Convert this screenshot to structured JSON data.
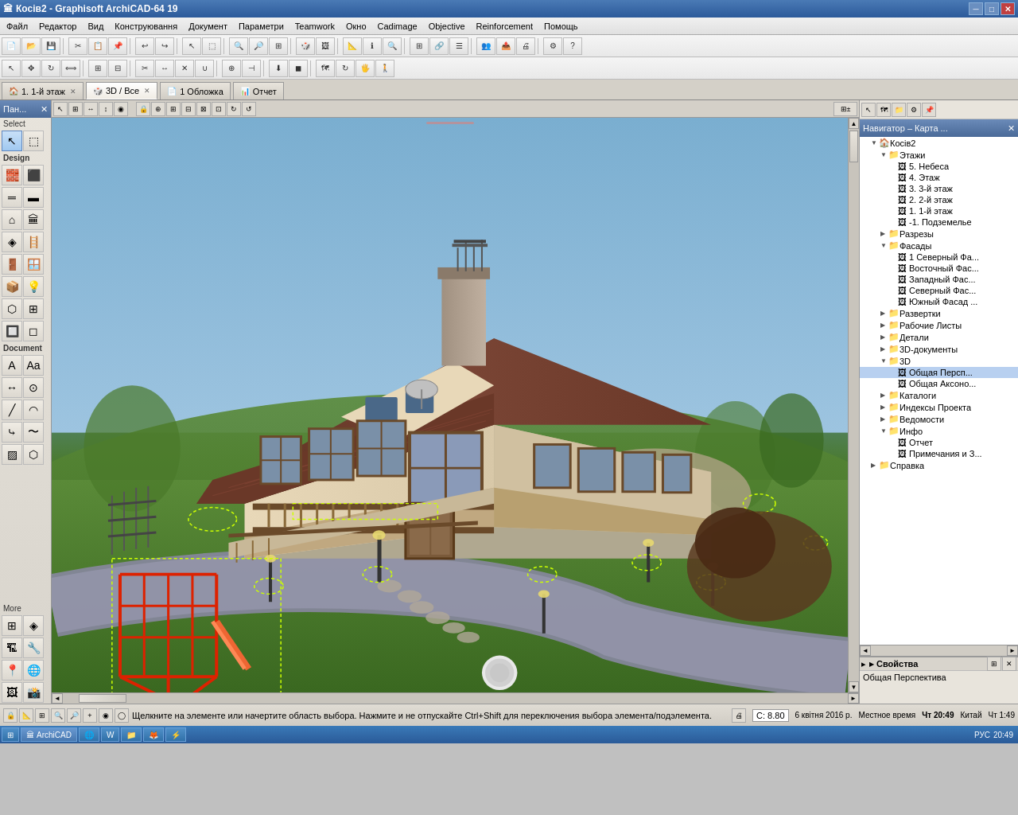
{
  "app": {
    "title": "Косів2 - Graphisoft ArchiCAD-64 19",
    "window_controls": [
      "minimize",
      "maximize",
      "close"
    ]
  },
  "menubar": {
    "items": [
      "Файл",
      "Редактор",
      "Вид",
      "Конструювання",
      "Документ",
      "Параметри",
      "Teamwork",
      "Окно",
      "Cadimage",
      "Objective",
      "Reinforcement",
      "Помощь"
    ]
  },
  "tabs": [
    {
      "label": "1. 1-й этаж",
      "icon": "floor",
      "active": false,
      "closeable": true
    },
    {
      "label": "3D / Все",
      "icon": "3d",
      "active": true,
      "closeable": true
    },
    {
      "label": "1 Обложка",
      "icon": "doc",
      "active": false,
      "closeable": false
    },
    {
      "label": "Отчет",
      "icon": "report",
      "active": false,
      "closeable": false
    }
  ],
  "left_panel": {
    "header": "Пан...",
    "select_label": "Select",
    "more_label": "More",
    "design_label": "Design",
    "document_label": "Document"
  },
  "navigator": {
    "header": "Навигатор – Карта ...",
    "tree": [
      {
        "level": 0,
        "label": "Косів2",
        "icon": "🏠",
        "expanded": true
      },
      {
        "level": 1,
        "label": "Этажи",
        "icon": "📁",
        "expanded": true
      },
      {
        "level": 2,
        "label": "5. Небеса",
        "icon": "🖼"
      },
      {
        "level": 2,
        "label": "4. Этаж",
        "icon": "🖼"
      },
      {
        "level": 2,
        "label": "3. 3-й этаж",
        "icon": "🖼"
      },
      {
        "level": 2,
        "label": "2. 2-й этаж",
        "icon": "🖼"
      },
      {
        "level": 2,
        "label": "1. 1-й этаж",
        "icon": "🖼"
      },
      {
        "level": 2,
        "label": "-1. Подземелье",
        "icon": "🖼"
      },
      {
        "level": 1,
        "label": "Разрезы",
        "icon": "📁"
      },
      {
        "level": 1,
        "label": "Фасады",
        "icon": "📁",
        "expanded": true
      },
      {
        "level": 2,
        "label": "1 Северный Фа...",
        "icon": "🖼"
      },
      {
        "level": 2,
        "label": "Восточный Фас...",
        "icon": "🖼"
      },
      {
        "level": 2,
        "label": "Западный Фас...",
        "icon": "🖼"
      },
      {
        "level": 2,
        "label": "Северный Фас...",
        "icon": "🖼"
      },
      {
        "level": 2,
        "label": "Южный Фасад ...",
        "icon": "🖼"
      },
      {
        "level": 1,
        "label": "Развертки",
        "icon": "📁"
      },
      {
        "level": 1,
        "label": "Рабочие Листы",
        "icon": "📁"
      },
      {
        "level": 1,
        "label": "Детали",
        "icon": "📁"
      },
      {
        "level": 1,
        "label": "3D-документы",
        "icon": "📁"
      },
      {
        "level": 1,
        "label": "3D",
        "icon": "📁",
        "expanded": true
      },
      {
        "level": 2,
        "label": "Общая Персп...",
        "icon": "🖼",
        "selected": true
      },
      {
        "level": 2,
        "label": "Общая Аксоно...",
        "icon": "🖼"
      },
      {
        "level": 1,
        "label": "Каталоги",
        "icon": "📁"
      },
      {
        "level": 1,
        "label": "Индексы Проекта",
        "icon": "📁"
      },
      {
        "level": 1,
        "label": "Ведомости",
        "icon": "📁"
      },
      {
        "level": 1,
        "label": "Инфо",
        "icon": "📁",
        "expanded": true
      },
      {
        "level": 2,
        "label": "Отчет",
        "icon": "🖼"
      },
      {
        "level": 2,
        "label": "Примечания и З...",
        "icon": "🖼"
      },
      {
        "level": 0,
        "label": "Справка",
        "icon": "📁"
      }
    ]
  },
  "properties": {
    "header": "▸ Свойства",
    "value": "Общая Перспектива"
  },
  "statusbar": {
    "text": "Щелкните на элементе или начертите область выбора. Нажмите и не отпускайте Ctrl+Shift для переключения выбора элемента/подэлемента.",
    "coord": "C: 8.80",
    "date": "6 квітня 2016 р.",
    "local_time_label": "Местное время",
    "time": "Чт 20:49",
    "region": "Китай",
    "time2": "Чт 1:49"
  },
  "taskbar": {
    "items": [
      "Start",
      "ArchiCAD",
      "Word",
      "Explorer",
      "Firefox",
      "Other"
    ]
  },
  "icons": {
    "minimize": "─",
    "maximize": "□",
    "close": "✕",
    "arrow_up": "▲",
    "arrow_down": "▼",
    "arrow_left": "◄",
    "arrow_right": "►"
  }
}
